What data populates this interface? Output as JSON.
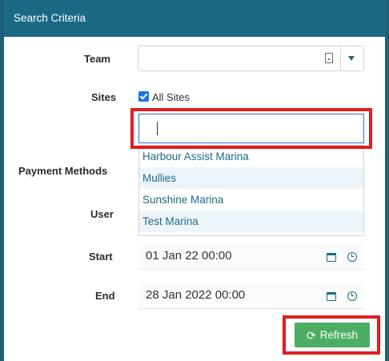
{
  "panel": {
    "title": "Search Criteria"
  },
  "labels": {
    "team": "Team",
    "sites": "Sites",
    "payment_methods": "Payment Methods",
    "user": "User",
    "start": "Start",
    "end": "End"
  },
  "team": {
    "value": "",
    "id_icon": "id-card-icon",
    "caret_icon": "caret-down-icon"
  },
  "sites": {
    "all_sites_label": "All Sites",
    "all_sites_checked": true,
    "search_value": "",
    "options": [
      "Harbour Assist Marina",
      "Mullies",
      "Sunshine Marina",
      "Test Marina"
    ]
  },
  "start": {
    "value": "01 Jan 22 00:00",
    "calendar_icon": "calendar-icon",
    "clock_icon": "clock-icon"
  },
  "end": {
    "value": "28 Jan 2022 00:00",
    "calendar_icon": "calendar-icon",
    "clock_icon": "clock-icon"
  },
  "refresh": {
    "label": "Refresh",
    "icon": "refresh-icon",
    "color": "#4cae63"
  },
  "colors": {
    "header": "#1a6a86",
    "highlight": "#e01e1e",
    "link": "#1e6a86"
  }
}
